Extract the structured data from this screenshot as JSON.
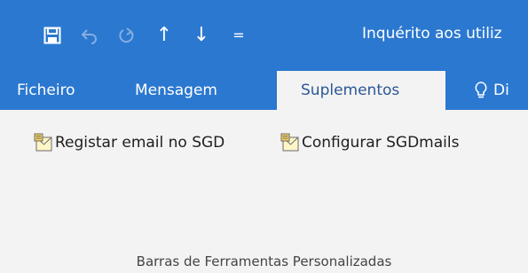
{
  "colors": {
    "accent": "#2b78d0",
    "ribbon_bg": "#f3f3f3",
    "active_tab_text": "#2b5797"
  },
  "quick_access": [
    {
      "name": "save-icon",
      "label": ""
    },
    {
      "name": "undo-icon",
      "label": ""
    },
    {
      "name": "redo-icon",
      "label": ""
    },
    {
      "name": "arrow-up-icon",
      "label": "↑"
    },
    {
      "name": "arrow-down-icon",
      "label": "↓"
    },
    {
      "name": "customize-qat-icon",
      "label": "="
    }
  ],
  "title": "Inquérito aos utiliz",
  "tabs": {
    "file": "Ficheiro",
    "message": "Mensagem",
    "addins": "Suplementos",
    "tell_me": "Di"
  },
  "ribbon": {
    "commands": {
      "register": "Registar email no SGD",
      "configure": "Configurar SGDmails"
    },
    "group_label": "Barras de Ferramentas Personalizadas"
  }
}
